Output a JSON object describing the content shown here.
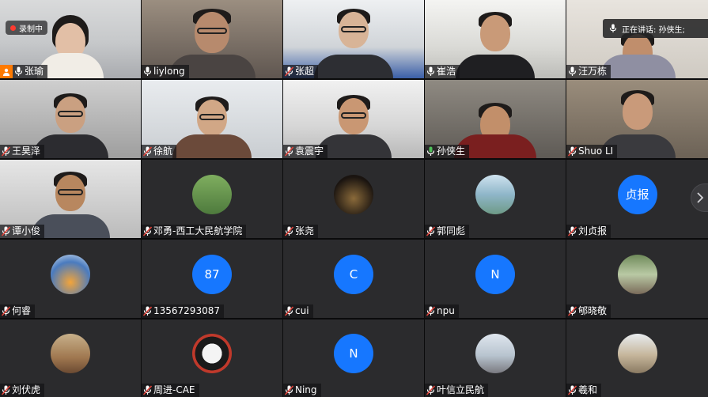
{
  "recording": {
    "label": "录制中"
  },
  "speaking": {
    "label": "正在讲话: 孙侠生;"
  },
  "participants": [
    {
      "name": "张瑜",
      "mic": "on",
      "host": true,
      "recording": true
    },
    {
      "name": "liylong",
      "mic": "on"
    },
    {
      "name": "张超",
      "mic": "muted"
    },
    {
      "name": "崔浩",
      "mic": "on"
    },
    {
      "name": "汪万栋",
      "mic": "on"
    },
    {
      "name": "王昊泽",
      "mic": "muted"
    },
    {
      "name": "徐航",
      "mic": "muted"
    },
    {
      "name": "袁震宇",
      "mic": "muted"
    },
    {
      "name": "孙侠生",
      "mic": "speaking"
    },
    {
      "name": "Shuo LI",
      "mic": "muted"
    },
    {
      "name": "谭小俊",
      "mic": "muted"
    },
    {
      "name": "邓勇-西工大民航学院",
      "mic": "muted"
    },
    {
      "name": "张尧",
      "mic": "muted"
    },
    {
      "name": "郭同彪",
      "mic": "muted"
    },
    {
      "name": "刘贞报",
      "mic": "muted",
      "avatar_text": "贞报"
    },
    {
      "name": "何睿",
      "mic": "muted"
    },
    {
      "name": "13567293087",
      "mic": "muted",
      "avatar_text": "87"
    },
    {
      "name": "cui",
      "mic": "muted",
      "avatar_text": "C"
    },
    {
      "name": "npu",
      "mic": "muted",
      "avatar_text": "N"
    },
    {
      "name": "郇晓敬",
      "mic": "muted"
    },
    {
      "name": "刘伏虎",
      "mic": "muted"
    },
    {
      "name": "周进-CAE",
      "mic": "muted"
    },
    {
      "name": "Ning",
      "mic": "muted",
      "avatar_text": "N"
    },
    {
      "name": "叶信立民航",
      "mic": "muted"
    },
    {
      "name": "羲和",
      "mic": "muted"
    }
  ],
  "colors": {
    "accent": "#1677ff",
    "speaking": "#4fbf5a",
    "recording": "#ff3b30",
    "muted": "#e0433a"
  },
  "icons": {
    "mic": "mic-icon",
    "muted": "mic-muted-icon",
    "host": "host-icon",
    "next": "chevron-right-icon"
  }
}
